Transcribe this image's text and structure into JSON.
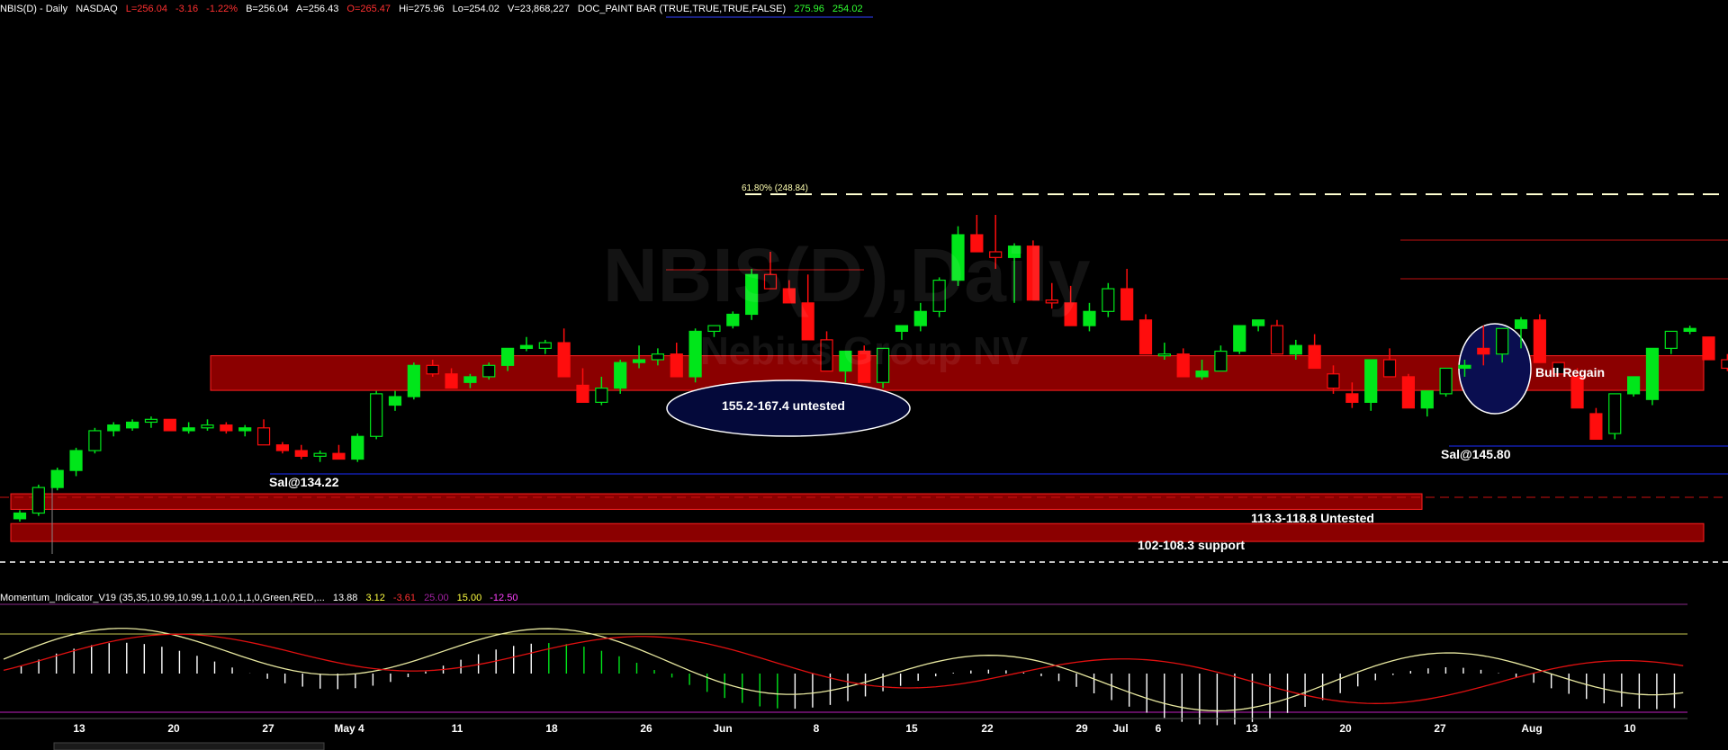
{
  "header": {
    "symbol": "NBIS(D) - Daily",
    "exchange": "NASDAQ",
    "last": "L=256.04",
    "change": "-3.16",
    "change_pct": "-1.22%",
    "bid": "B=256.04",
    "ask": "A=256.43",
    "open": "O=265.47",
    "high": "Hi=275.96",
    "low": "Lo=254.02",
    "volume": "V=23,868,227",
    "study": "DOC_PAINT BAR (TRUE,TRUE,TRUE,FALSE)",
    "study_v1": "275.96",
    "study_v2": "254.02"
  },
  "watermark": {
    "title": "NBIS(D),Daily",
    "subtitle": "Nebius Group NV"
  },
  "indicator_header": {
    "name": "Momentum_Indicator_V19 (35,35,10.99,10.99,1,1,0,0,1,1,0,Green,RED,...",
    "v1": "13.88",
    "v2": "3.12",
    "v3": "-3.61",
    "v4": "25.00",
    "v5": "15.00",
    "v6": "-12.50"
  },
  "annotations": {
    "zone_upper": "155.2-167.4 untested",
    "zone_mid": "113.3-118.8 Untested",
    "zone_low": "102-108.3 support",
    "sal1": "Sal@134.22",
    "sal2": "Sal@145.80",
    "bull": "Bull Regain",
    "fib": "61.80% (248.84)"
  },
  "colors": {
    "up": "#00e61a",
    "down": "#ff0d0d",
    "zone": "#8b0000",
    "fib": "#ffffd0",
    "osc": "#e8e8a0",
    "signal": "#e01010"
  },
  "chart_data": {
    "type": "candlestick",
    "title": "NBIS(D),Daily",
    "ylim": [
      90,
      280
    ],
    "x_ticks": [
      "13",
      "20",
      "27",
      "May 4",
      "11",
      "18",
      "26",
      "Jun",
      "8",
      "15",
      "22",
      "29",
      "Jul",
      "6",
      "13",
      "20",
      "27",
      "Aug",
      "10"
    ],
    "candles": [
      [
        110,
        113,
        109,
        112
      ],
      [
        112,
        122,
        111,
        121
      ],
      [
        121,
        128,
        120,
        127
      ],
      [
        127,
        135,
        125,
        134
      ],
      [
        134,
        142,
        133,
        141
      ],
      [
        141,
        144,
        139,
        143
      ],
      [
        142,
        145,
        141,
        144
      ],
      [
        144,
        146,
        142,
        145
      ],
      [
        145,
        143,
        144,
        141
      ],
      [
        141,
        144,
        140,
        142
      ],
      [
        142,
        145,
        141,
        143
      ],
      [
        143,
        144,
        140,
        141
      ],
      [
        141,
        143,
        139,
        142
      ],
      [
        142,
        145,
        140,
        136
      ],
      [
        136,
        137,
        133,
        134
      ],
      [
        134,
        136,
        131,
        132
      ],
      [
        132,
        134,
        130,
        133
      ],
      [
        133,
        136,
        131,
        131
      ],
      [
        131,
        140,
        130,
        139
      ],
      [
        139,
        155,
        138,
        154
      ],
      [
        150,
        155,
        148,
        153
      ],
      [
        153,
        165,
        152,
        164
      ],
      [
        164,
        166,
        160,
        161
      ],
      [
        161,
        158,
        163,
        156
      ],
      [
        158,
        161,
        156,
        160
      ],
      [
        160,
        165,
        159,
        164
      ],
      [
        164,
        170,
        162,
        170
      ],
      [
        170,
        174,
        169,
        171
      ],
      [
        170,
        173,
        168,
        172
      ],
      [
        172,
        171,
        177,
        160
      ],
      [
        157,
        155,
        163,
        151
      ],
      [
        151,
        150,
        160,
        156
      ],
      [
        156,
        166,
        154,
        165
      ],
      [
        165,
        171,
        163,
        166
      ],
      [
        166,
        170,
        164,
        168
      ],
      [
        168,
        167,
        172,
        160
      ],
      [
        160,
        177,
        158,
        176
      ],
      [
        176,
        177,
        174,
        178
      ],
      [
        178,
        177,
        183,
        182
      ],
      [
        182,
        198,
        180,
        196
      ],
      [
        196,
        204,
        194,
        191
      ],
      [
        191,
        188,
        194,
        186
      ],
      [
        186,
        182,
        196,
        173
      ],
      [
        173,
        170,
        176,
        162
      ],
      [
        162,
        158,
        166,
        169
      ],
      [
        169,
        160,
        171,
        158
      ],
      [
        158,
        164,
        156,
        170
      ],
      [
        176,
        173,
        178,
        178
      ],
      [
        178,
        176,
        186,
        183
      ],
      [
        183,
        195,
        181,
        194
      ],
      [
        194,
        213,
        192,
        210
      ],
      [
        210,
        217,
        208,
        204
      ],
      [
        204,
        198,
        217,
        202
      ],
      [
        202,
        207,
        186,
        206
      ],
      [
        206,
        208,
        202,
        187
      ],
      [
        187,
        184,
        193,
        186
      ],
      [
        186,
        184,
        192,
        178
      ],
      [
        178,
        176,
        186,
        183
      ],
      [
        183,
        193,
        181,
        191
      ],
      [
        191,
        189,
        198,
        180
      ],
      [
        180,
        180,
        182,
        168
      ],
      [
        168,
        166,
        172,
        168
      ],
      [
        168,
        168,
        170,
        160
      ],
      [
        160,
        159,
        166,
        162
      ],
      [
        162,
        165,
        171,
        169
      ],
      [
        169,
        176,
        168,
        178
      ],
      [
        178,
        179,
        176,
        180
      ],
      [
        178,
        175,
        180,
        168
      ],
      [
        168,
        173,
        166,
        171
      ],
      [
        171,
        163,
        175,
        163
      ],
      [
        161,
        154,
        164,
        156
      ],
      [
        154,
        149,
        158,
        151
      ],
      [
        151,
        155,
        148,
        166
      ],
      [
        166,
        165,
        170,
        160
      ],
      [
        160,
        161,
        158,
        149
      ],
      [
        149,
        150,
        146,
        155
      ],
      [
        154,
        153,
        162,
        163
      ],
      [
        163,
        166,
        160,
        164
      ],
      [
        170,
        164,
        178,
        168
      ],
      [
        168,
        169,
        165,
        177
      ],
      [
        177,
        181,
        170,
        180
      ],
      [
        180,
        171,
        182,
        165
      ],
      [
        165,
        164,
        162,
        161
      ],
      [
        160,
        154,
        163,
        149
      ],
      [
        147,
        149,
        144,
        138
      ],
      [
        140,
        153,
        138,
        154
      ],
      [
        154,
        159,
        153,
        160
      ],
      [
        152,
        167,
        150,
        170
      ],
      [
        170,
        175,
        168,
        176
      ],
      [
        176,
        178,
        175,
        177
      ],
      [
        174,
        176,
        176,
        166
      ],
      [
        166,
        162,
        168,
        163
      ],
      [
        163,
        162,
        165,
        162
      ],
      [
        162,
        166,
        160,
        166
      ],
      [
        167,
        169,
        160,
        191
      ],
      [
        191,
        192,
        189,
        190
      ]
    ]
  }
}
